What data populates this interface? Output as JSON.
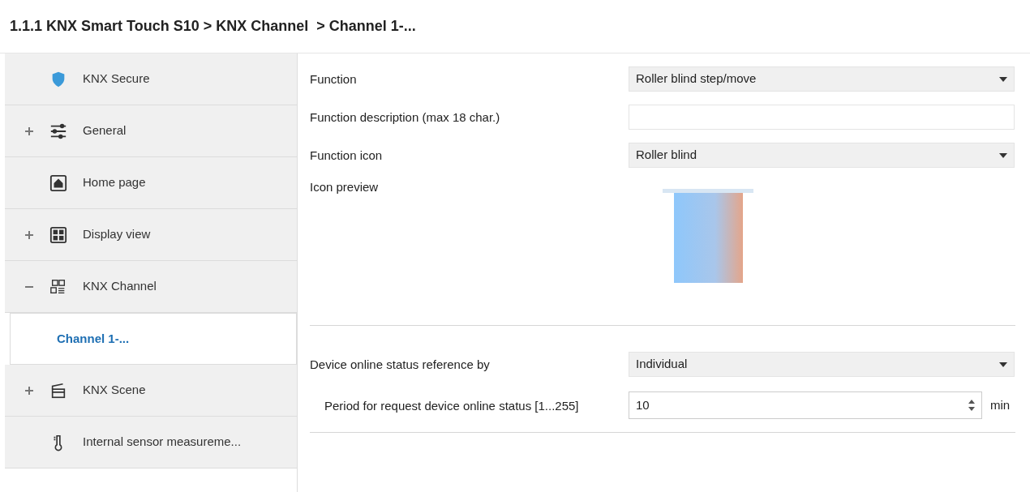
{
  "breadcrumb": "1.1.1 KNX Smart Touch S10 > KNX Channel  > Channel 1-...",
  "sidebar": {
    "items": [
      {
        "label": "KNX Secure",
        "selected": false
      },
      {
        "label": "General",
        "expanded": false,
        "selected": false
      },
      {
        "label": "Home page",
        "selected": false
      },
      {
        "label": "Display view",
        "expanded": false,
        "selected": false
      },
      {
        "label": "KNX Channel",
        "expanded": true,
        "selected": false,
        "children": [
          {
            "label": "Channel 1-...",
            "selected": true
          }
        ]
      },
      {
        "label": "KNX Scene",
        "expanded": false,
        "selected": false
      },
      {
        "label": "Internal sensor measureme...",
        "selected": false
      }
    ]
  },
  "sections": [
    {
      "params": [
        {
          "kind": "select",
          "label": "Function",
          "value": "Roller blind step/move"
        },
        {
          "kind": "text",
          "label": "Function description (max 18 char.)"
        },
        {
          "kind": "select",
          "label": "Function icon",
          "value": "Roller blind"
        },
        {
          "kind": "preview",
          "label": "Icon preview"
        }
      ]
    },
    {
      "params": [
        {
          "kind": "select",
          "label": "Device online status reference by",
          "value": "Individual"
        },
        {
          "kind": "spin",
          "label": "Period for request device online status [1...255]",
          "value": "10",
          "unit": "min"
        }
      ]
    }
  ]
}
